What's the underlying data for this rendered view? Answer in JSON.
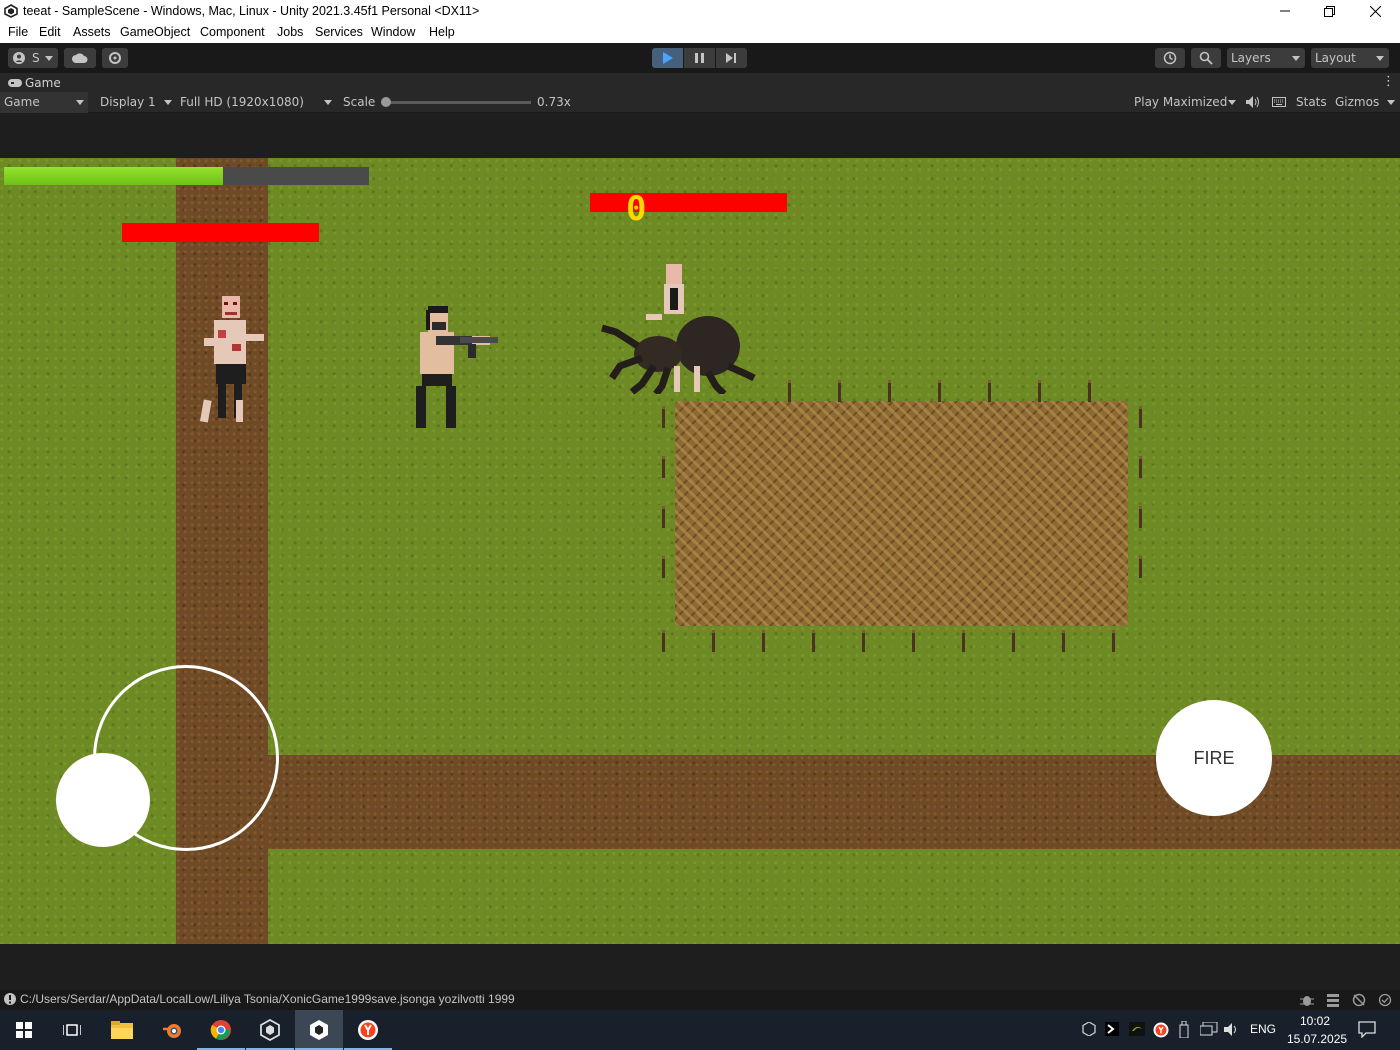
{
  "window": {
    "title": "teeat - SampleScene - Windows, Mac, Linux - Unity 2021.3.45f1 Personal <DX11>",
    "controls": [
      "minimize-icon",
      "restore-icon",
      "close-icon"
    ]
  },
  "menu": [
    "File",
    "Edit",
    "Assets",
    "GameObject",
    "Component",
    "Jobs",
    "Services",
    "Window",
    "Help"
  ],
  "toolbar": {
    "account_label": "S",
    "layers_label": "Layers",
    "layout_label": "Layout",
    "play_active": true
  },
  "game_tab": {
    "tab_label": "Game",
    "view_mode": "Game",
    "display": "Display 1",
    "resolution": "Full HD (1920x1080)",
    "scale_label": "Scale",
    "scale_value": "0.73x",
    "play_maximized": "Play Maximized",
    "stats": "Stats",
    "gizmos": "Gizmos"
  },
  "game": {
    "player_health_fraction": 0.6,
    "score": "0",
    "fire_label": "FIRE",
    "colors": {
      "health_green": "#8fdc26",
      "enemy_hp_red": "#ff0000",
      "score_yellow": "#ffd800"
    }
  },
  "status": {
    "message": "C:/Users/Serdar/AppData/LocalLow/Liliya Tsonia/XonicGame1999save.jsonga yozilvotti 1999"
  },
  "taskbar": {
    "apps": [
      "windows-start-icon",
      "task-view-icon",
      "file-explorer-icon",
      "blender-icon",
      "chrome-icon",
      "unity-hub-icon",
      "unity-editor-icon",
      "yandex-browser-icon"
    ],
    "language": "ENG",
    "time": "10:02",
    "date": "15.07.2025"
  }
}
